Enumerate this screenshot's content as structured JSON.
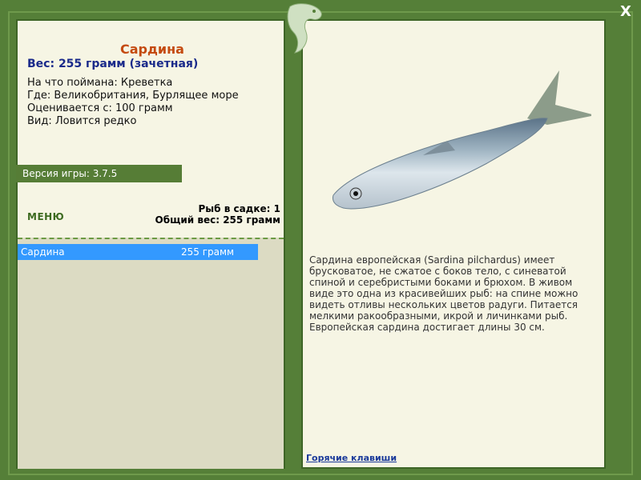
{
  "window": {
    "close_label": "X"
  },
  "fish": {
    "name": "Сардина",
    "weight_line": "Вес: 255 грамм (зачетная)",
    "bait": "На что поймана: Креветка",
    "location": "Где: Великобритания, Бурлящее море",
    "rated_from": "Оценивается с: 100 грамм",
    "rarity": "Вид: Ловится редко"
  },
  "version": "Версия игры: 3.7.5",
  "menu_label": "МЕНЮ",
  "keepnet": {
    "count": "Рыб в садке: 1",
    "total_weight": "Общий вес: 255 грамм",
    "items": [
      {
        "name": "Сардина",
        "weight": "255 грамм"
      }
    ]
  },
  "description": "Сардина европейская (Sardina pilchardus) имеет брусковатое, не сжатое с боков тело, с синеватой спиной и серебристыми боками и брюхом. В живом виде это одна из красивейших рыб: на спине можно видеть отливы нескольких цветов радуги. Питается мелкими ракообразными, икрой и личинками рыб. Европейская сардина достигает длины 30 см.",
  "hotkeys_label": "Горячие клавиши",
  "colors": {
    "frame": "#557f38",
    "panel": "#f6f5e4",
    "selected_row": "#3399ff",
    "title": "#c44a10",
    "weight": "#1a2a8a"
  }
}
